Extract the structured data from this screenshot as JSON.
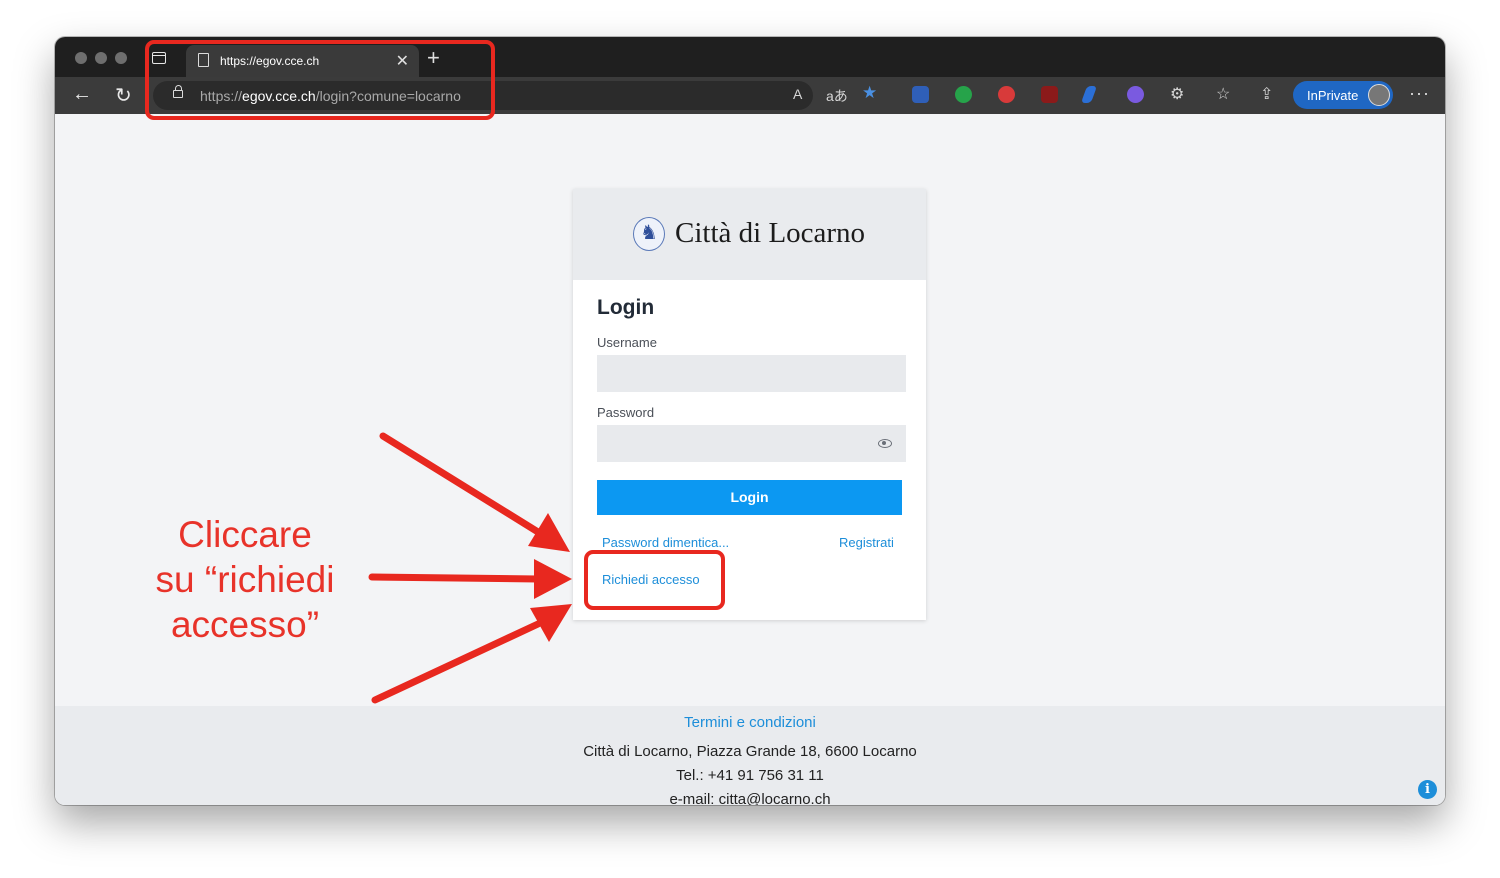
{
  "browser": {
    "tab_title": "https://egov.cce.ch",
    "tab_close": "✕",
    "new_tab": "+",
    "url_prefix": "https://",
    "url_host": "egov.cce.ch",
    "url_path": "/login?comune=locarno",
    "read_aloud": "A",
    "translate": "aあ",
    "inprivate_label": "InPrivate",
    "more": "···"
  },
  "card": {
    "brand": "Città di Locarno",
    "title": "Login",
    "username_label": "Username",
    "password_label": "Password",
    "login_button": "Login",
    "forgot_link": "Password dimentica...",
    "register_link": "Registrati",
    "request_access_link": "Richiedi accesso"
  },
  "footer": {
    "terms_link": "Termini e condizioni",
    "address": "Città di Locarno, Piazza Grande 18, 6600 Locarno",
    "phone": "Tel.: +41 91 756 31 11",
    "email": "e-mail: citta@locarno.ch",
    "info": "i"
  },
  "annotation": {
    "line1": "Cliccare",
    "line2": "su “richiedi",
    "line3": "accesso”"
  },
  "colors": {
    "accent": "#0c98f2",
    "link": "#1d8ed9",
    "annotation_red": "#e8281f"
  }
}
